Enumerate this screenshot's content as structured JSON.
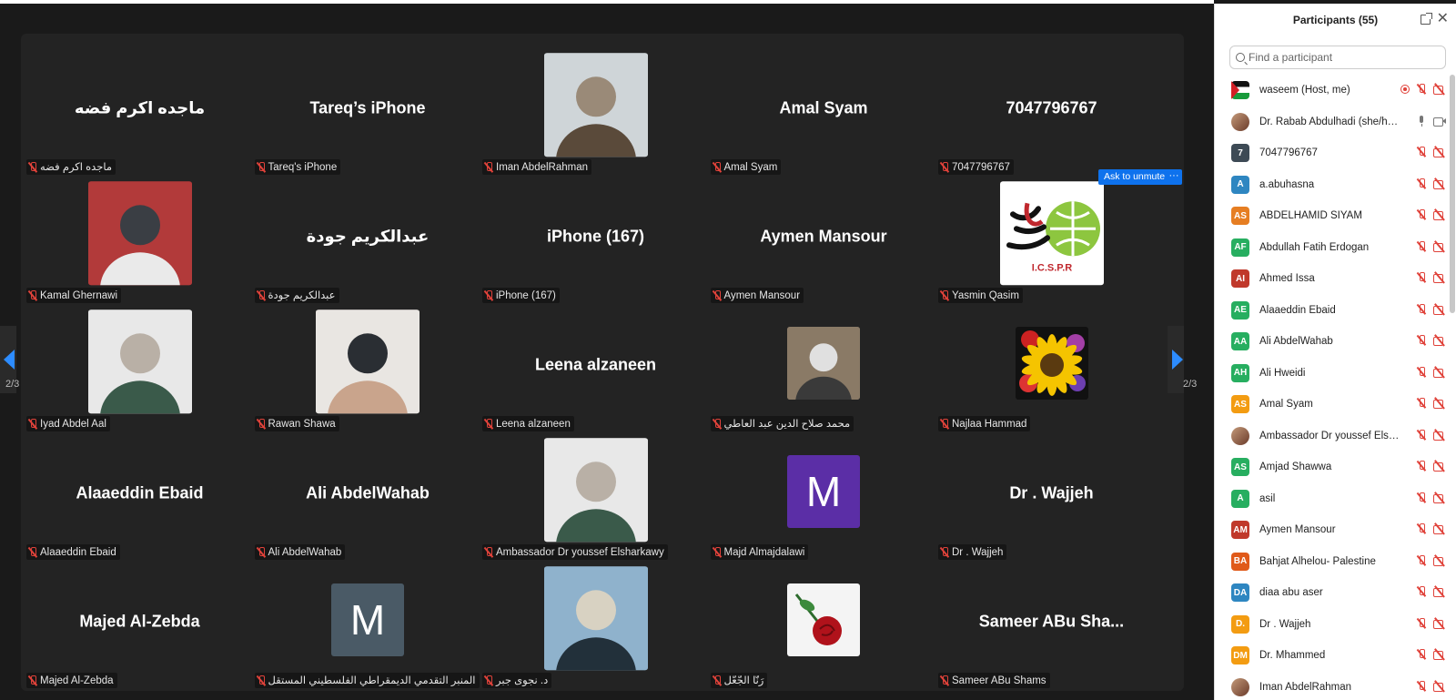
{
  "colors": {
    "background": "#1a1a1a",
    "tile": "#232323",
    "accent": "#0e72ed",
    "muted_red": "#e0423a"
  },
  "gallery": {
    "page_indicator_left": "2/3",
    "page_indicator_right": "2/3",
    "ask_to_unmute": "Ask to unmute",
    "more_label": "···",
    "tiles": [
      {
        "display": "ماجده اكرم فضه",
        "label": "ماجده اكرم فضه",
        "kind": "text"
      },
      {
        "display": "Tareq’s iPhone",
        "label": "Tareq's iPhone",
        "kind": "text"
      },
      {
        "display": "",
        "label": "Iman AbdelRahman",
        "kind": "photo"
      },
      {
        "display": "Amal Syam",
        "label": "Amal Syam",
        "kind": "text"
      },
      {
        "display": "7047796767",
        "label": "7047796767",
        "kind": "text"
      },
      {
        "display": "",
        "label": "Kamal Ghernawi",
        "kind": "photo"
      },
      {
        "display": "عبدالكريم جودة",
        "label": "عبدالكريم جودة",
        "kind": "text"
      },
      {
        "display": "iPhone (167)",
        "label": "iPhone (167)",
        "kind": "text"
      },
      {
        "display": "Aymen Mansour",
        "label": "Aymen Mansour",
        "kind": "text"
      },
      {
        "display": "",
        "label": "Yasmin Qasim",
        "kind": "logo",
        "logo_text": "I.C.S.P.R"
      },
      {
        "display": "",
        "label": "Iyad Abdel Aal",
        "kind": "photo"
      },
      {
        "display": "",
        "label": "Rawan Shawa",
        "kind": "photo"
      },
      {
        "display": "Leena alzaneen",
        "label": "Leena alzaneen",
        "kind": "text"
      },
      {
        "display": "",
        "label": "محمد صلاح الدين عبد العاطي",
        "kind": "photo-small"
      },
      {
        "display": "",
        "label": "Najlaa Hammad",
        "kind": "flowers"
      },
      {
        "display": "Alaaeddin Ebaid",
        "label": "Alaaeddin Ebaid",
        "kind": "text"
      },
      {
        "display": "Ali AbdelWahab",
        "label": "Ali AbdelWahab",
        "kind": "text"
      },
      {
        "display": "",
        "label": "Ambassador Dr youssef Elsharkawy",
        "kind": "photo"
      },
      {
        "display": "M",
        "label": "Majd Almajdalawi",
        "kind": "letter",
        "color": "#5b2ea6"
      },
      {
        "display": "Dr . Wajjeh",
        "label": "Dr . Wajjeh",
        "kind": "text"
      },
      {
        "display": "Majed Al-Zebda",
        "label": "Majed Al-Zebda",
        "kind": "text"
      },
      {
        "display": "M",
        "label": "المنبر التقدمي الديمقراطي الفلسطيني المستقل",
        "kind": "letter",
        "color": "#4a5a66"
      },
      {
        "display": "",
        "label": "د. نجوى جبر",
        "kind": "photo"
      },
      {
        "display": "",
        "label": "رَنّا الجّعّل",
        "kind": "rose"
      },
      {
        "display": "Sameer ABu Sha...",
        "label": "Sameer ABu Shams",
        "kind": "text"
      }
    ]
  },
  "panel": {
    "title": "Participants (55)",
    "close": "✕",
    "search_placeholder": "Find a participant",
    "participants": [
      {
        "initials": "",
        "name": "waseem (Host, me)",
        "color": "flag",
        "mic": "off",
        "cam": "off",
        "rec": true
      },
      {
        "initials": "",
        "name": "Dr. Rabab Abdulhadi (she/her),...",
        "color": "photo",
        "mic": "on",
        "cam": "on"
      },
      {
        "initials": "7",
        "name": "7047796767",
        "color": "#3d4a55",
        "mic": "off",
        "cam": "off"
      },
      {
        "initials": "A",
        "name": "a.abuhasna",
        "color": "#2e86c1",
        "mic": "off",
        "cam": "off"
      },
      {
        "initials": "AS",
        "name": "ABDELHAMID SIYAM",
        "color": "#e67e22",
        "mic": "off",
        "cam": "off"
      },
      {
        "initials": "AF",
        "name": "Abdullah Fatih Erdogan",
        "color": "#27ae60",
        "mic": "off",
        "cam": "off"
      },
      {
        "initials": "AI",
        "name": "Ahmed Issa",
        "color": "#c0392b",
        "mic": "off",
        "cam": "off"
      },
      {
        "initials": "AE",
        "name": "Alaaeddin Ebaid",
        "color": "#27ae60",
        "mic": "off",
        "cam": "off"
      },
      {
        "initials": "AA",
        "name": "Ali AbdelWahab",
        "color": "#27ae60",
        "mic": "off",
        "cam": "off"
      },
      {
        "initials": "AH",
        "name": "Ali Hweidi",
        "color": "#27ae60",
        "mic": "off",
        "cam": "off"
      },
      {
        "initials": "AS",
        "name": "Amal Syam",
        "color": "#f39c12",
        "mic": "off",
        "cam": "off"
      },
      {
        "initials": "",
        "name": "Ambassador Dr youssef Elshar...",
        "color": "photo",
        "mic": "off",
        "cam": "off"
      },
      {
        "initials": "AS",
        "name": "Amjad Shawwa",
        "color": "#27ae60",
        "mic": "off",
        "cam": "off"
      },
      {
        "initials": "A",
        "name": "asil",
        "color": "#27ae60",
        "mic": "off",
        "cam": "off"
      },
      {
        "initials": "AM",
        "name": "Aymen Mansour",
        "color": "#c0392b",
        "mic": "off",
        "cam": "off"
      },
      {
        "initials": "BA",
        "name": "Bahjat Alhelou- Palestine",
        "color": "#e05a1a",
        "mic": "off",
        "cam": "off"
      },
      {
        "initials": "DA",
        "name": "diaa abu aser",
        "color": "#2e86c1",
        "mic": "off",
        "cam": "off"
      },
      {
        "initials": "D.",
        "name": "Dr . Wajjeh",
        "color": "#f39c12",
        "mic": "off",
        "cam": "off"
      },
      {
        "initials": "DM",
        "name": "Dr. Mhammed",
        "color": "#f39c12",
        "mic": "off",
        "cam": "off"
      },
      {
        "initials": "",
        "name": "Iman AbdelRahman",
        "color": "photo",
        "mic": "off",
        "cam": "off"
      }
    ]
  }
}
